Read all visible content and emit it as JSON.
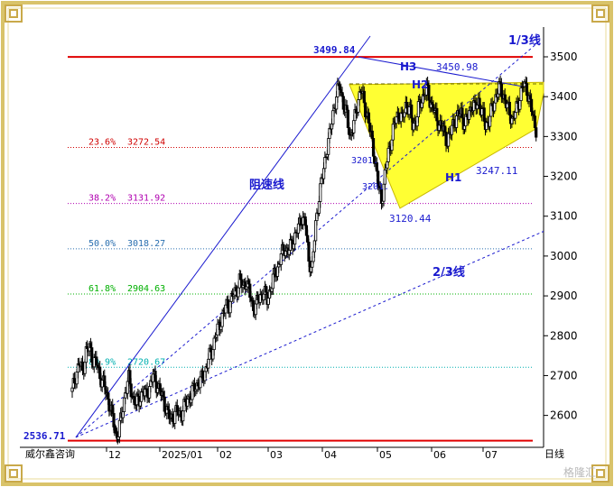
{
  "footer": {
    "brand": "威尔鑫咨询",
    "period": "日线",
    "watermark": "格隆汇"
  },
  "colors": {
    "frame": "#d9c36a",
    "red": "#e00000",
    "blue": "#1a1acf",
    "yellow": "#ffff33",
    "fib_23": "#d00000",
    "fib_38": "#b000b0",
    "fib_50": "#2a6fb0",
    "fib_61": "#00b000",
    "fib_80": "#00b0b0"
  },
  "chart_data": {
    "type": "candlestick",
    "title": "",
    "ylim": [
      2530,
      3550
    ],
    "y_ticks": [
      2600,
      2700,
      2800,
      2900,
      3000,
      3100,
      3200,
      3300,
      3400,
      3500
    ],
    "x_ticks": [
      "12",
      "2025/01",
      "02",
      "03",
      "04",
      "05",
      "06",
      "07"
    ],
    "h_lines": [
      {
        "name": "high",
        "value": 3499.84
      },
      {
        "name": "low",
        "value": 2536.71
      }
    ],
    "fib_levels": [
      {
        "pct": "23.6%",
        "value": "3272.54",
        "price": 3272.54,
        "color_key": "fib_23"
      },
      {
        "pct": "38.2%",
        "value": "3131.92",
        "price": 3131.92,
        "color_key": "fib_38"
      },
      {
        "pct": "50.0%",
        "value": "3018.27",
        "price": 3018.27,
        "color_key": "fib_50"
      },
      {
        "pct": "61.8%",
        "value": "2904.63",
        "price": 2904.63,
        "color_key": "fib_61"
      },
      {
        "pct": "80.9%",
        "value": "2720.67",
        "price": 2720.67,
        "color_key": "fib_80"
      }
    ],
    "annotations": {
      "high_price": "3499.84",
      "low_price": "2536.71",
      "h3_price": "3450.98",
      "p1": "3201.",
      "p2": "3201.",
      "bottom": "3120.44",
      "h1_price": "3247.11",
      "h3": "H3",
      "h2": "H2",
      "h1": "H1",
      "one_third": "1/3线",
      "two_third": "2/3线",
      "resist": "阻速线"
    },
    "price_path": [
      [
        0,
        2660
      ],
      [
        3,
        2700
      ],
      [
        6,
        2730
      ],
      [
        9,
        2710
      ],
      [
        12,
        2760
      ],
      [
        15,
        2770
      ],
      [
        18,
        2740
      ],
      [
        21,
        2730
      ],
      [
        24,
        2700
      ],
      [
        27,
        2680
      ],
      [
        30,
        2650
      ],
      [
        33,
        2620
      ],
      [
        36,
        2580
      ],
      [
        38,
        2550
      ],
      [
        40,
        2560
      ],
      [
        43,
        2600
      ],
      [
        46,
        2660
      ],
      [
        49,
        2690
      ],
      [
        52,
        2650
      ],
      [
        55,
        2630
      ],
      [
        58,
        2640
      ],
      [
        61,
        2660
      ],
      [
        64,
        2650
      ],
      [
        67,
        2670
      ],
      [
        70,
        2700
      ],
      [
        73,
        2680
      ],
      [
        76,
        2660
      ],
      [
        79,
        2640
      ],
      [
        82,
        2610
      ],
      [
        85,
        2590
      ],
      [
        88,
        2600
      ],
      [
        91,
        2610
      ],
      [
        94,
        2600
      ],
      [
        97,
        2620
      ],
      [
        100,
        2640
      ],
      [
        103,
        2650
      ],
      [
        106,
        2670
      ],
      [
        109,
        2680
      ],
      [
        112,
        2690
      ],
      [
        115,
        2710
      ],
      [
        118,
        2740
      ],
      [
        121,
        2760
      ],
      [
        124,
        2800
      ],
      [
        127,
        2820
      ],
      [
        130,
        2850
      ],
      [
        133,
        2870
      ],
      [
        136,
        2880
      ],
      [
        139,
        2900
      ],
      [
        142,
        2910
      ],
      [
        145,
        2940
      ],
      [
        148,
        2920
      ],
      [
        151,
        2940
      ],
      [
        154,
        2900
      ],
      [
        157,
        2870
      ],
      [
        160,
        2880
      ],
      [
        163,
        2900
      ],
      [
        166,
        2910
      ],
      [
        169,
        2890
      ],
      [
        172,
        2920
      ],
      [
        175,
        2950
      ],
      [
        178,
        2970
      ],
      [
        181,
        3000
      ],
      [
        184,
        3020
      ],
      [
        187,
        3010
      ],
      [
        190,
        3030
      ],
      [
        193,
        3050
      ],
      [
        196,
        3070
      ],
      [
        199,
        3100
      ],
      [
        202,
        3080
      ],
      [
        205,
        2990
      ],
      [
        208,
        2970
      ],
      [
        211,
        3080
      ],
      [
        214,
        3150
      ],
      [
        217,
        3200
      ],
      [
        220,
        3260
      ],
      [
        223,
        3300
      ],
      [
        226,
        3360
      ],
      [
        229,
        3400
      ],
      [
        232,
        3430
      ],
      [
        235,
        3380
      ],
      [
        238,
        3350
      ],
      [
        241,
        3300
      ],
      [
        244,
        3330
      ],
      [
        247,
        3380
      ],
      [
        250,
        3420
      ],
      [
        253,
        3380
      ],
      [
        256,
        3350
      ],
      [
        259,
        3300
      ],
      [
        262,
        3250
      ],
      [
        265,
        3180
      ],
      [
        268,
        3140
      ],
      [
        271,
        3200
      ],
      [
        274,
        3260
      ],
      [
        277,
        3300
      ],
      [
        280,
        3340
      ],
      [
        283,
        3360
      ],
      [
        286,
        3340
      ],
      [
        289,
        3380
      ],
      [
        292,
        3370
      ],
      [
        295,
        3330
      ],
      [
        298,
        3340
      ],
      [
        301,
        3380
      ],
      [
        304,
        3400
      ],
      [
        307,
        3420
      ],
      [
        310,
        3390
      ],
      [
        313,
        3370
      ],
      [
        316,
        3340
      ],
      [
        319,
        3330
      ],
      [
        322,
        3310
      ],
      [
        325,
        3290
      ],
      [
        328,
        3310
      ],
      [
        331,
        3340
      ],
      [
        334,
        3350
      ],
      [
        337,
        3360
      ],
      [
        340,
        3330
      ],
      [
        343,
        3350
      ],
      [
        346,
        3380
      ],
      [
        349,
        3370
      ],
      [
        352,
        3390
      ],
      [
        355,
        3360
      ],
      [
        358,
        3330
      ],
      [
        361,
        3340
      ],
      [
        364,
        3370
      ],
      [
        367,
        3400
      ],
      [
        370,
        3420
      ],
      [
        373,
        3410
      ],
      [
        376,
        3380
      ],
      [
        379,
        3360
      ],
      [
        382,
        3340
      ],
      [
        385,
        3370
      ],
      [
        388,
        3400
      ],
      [
        391,
        3430
      ],
      [
        394,
        3420
      ],
      [
        397,
        3380
      ],
      [
        400,
        3340
      ],
      [
        403,
        3310
      ]
    ]
  }
}
